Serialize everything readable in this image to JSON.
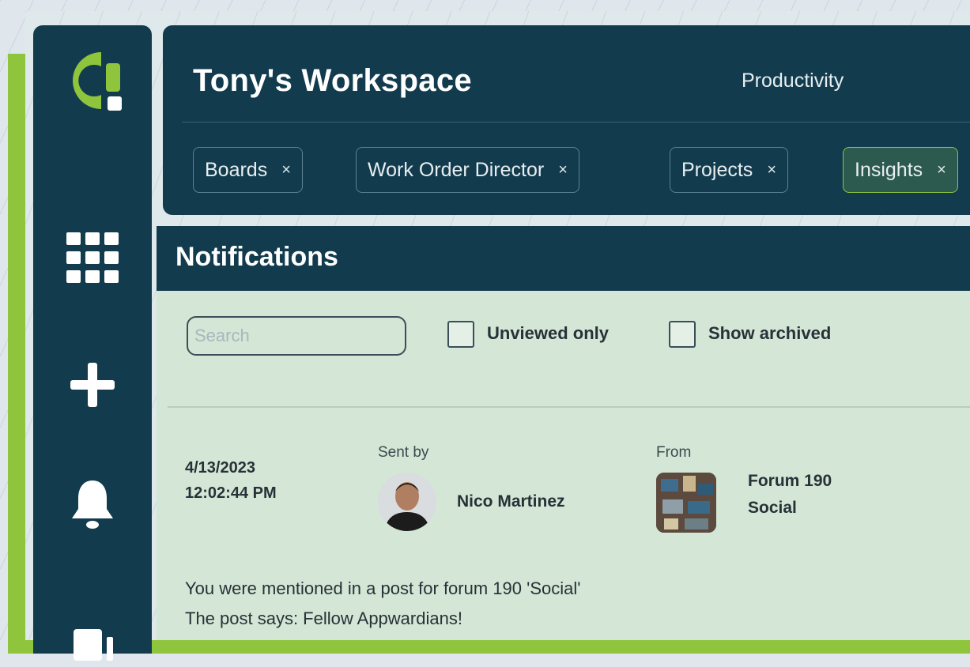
{
  "workspace": {
    "title": "Tony's Workspace",
    "nav_link": "Productivity"
  },
  "tabs": [
    {
      "label": "Boards",
      "close": "×"
    },
    {
      "label": "Work Order Director",
      "close": "×"
    },
    {
      "label": "Projects",
      "close": "×"
    },
    {
      "label": "Insights",
      "close": "×",
      "active": true
    }
  ],
  "sidebar": {
    "icons": [
      "app-logo",
      "apps-grid-icon",
      "plus-icon",
      "bell-icon",
      "document-icon"
    ]
  },
  "notifications": {
    "title": "Notifications",
    "search_placeholder": "Search",
    "filters": {
      "unviewed_only": "Unviewed only",
      "show_archived": "Show archived"
    },
    "item": {
      "date": "4/13/2023",
      "time": "12:02:44 PM",
      "sent_by_label": "Sent by",
      "sender": "Nico Martinez",
      "from_label": "From",
      "source_line1": "Forum 190",
      "source_line2": "Social",
      "message_line1": "You were mentioned in a post for forum 190 'Social'",
      "message_line2": "The post says: Fellow Appwardians!"
    }
  },
  "colors": {
    "navy": "#123c4e",
    "accent_green": "#8fc43d",
    "panel_green": "#d4e6d5"
  }
}
